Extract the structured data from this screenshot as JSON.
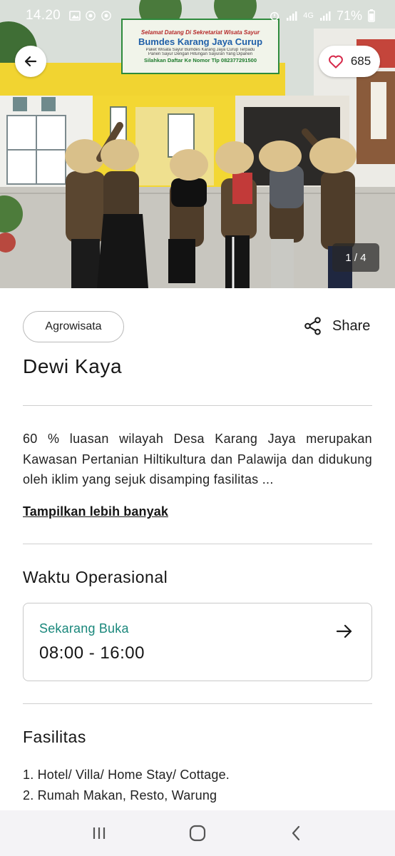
{
  "status_bar": {
    "time": "14.20",
    "battery": "71%",
    "network": "4G"
  },
  "hero": {
    "likes": "685",
    "image_counter": "1 / 4",
    "banner": {
      "top_line": "Selamat Datang Di Sekretariat Wisata Sayur",
      "title": "Bumdes Karang Jaya Curup",
      "line_1": "Paket Wisata Sayur Bumdes Karang Jaya Curup Terpadu",
      "line_2": "Panen Sayur Dengan Hitungan Sayuran Yang Dipanen",
      "bottom_line": "Silahkan Daftar Ke Nomor Tlp 082377291500"
    }
  },
  "chip": {
    "label": "Agrowisata"
  },
  "share": {
    "label": "Share"
  },
  "place": {
    "name": "Dewi Kaya"
  },
  "description": {
    "text": "60 % luasan wilayah Desa Karang Jaya merupakan Kawasan Pertanian Hiltikultura dan Palawija dan didukung oleh iklim yang sejuk disamping fasilitas ...",
    "more_link": "Tampilkan lebih banyak"
  },
  "operating_hours": {
    "section_title": "Waktu Operasional",
    "status": "Sekarang Buka",
    "hours": "08:00 - 16:00"
  },
  "facilities": {
    "section_title": "Fasilitas",
    "items": [
      "1. Hotel/ Villa/ Home Stay/ Cottage.",
      "2. Rumah Makan, Resto, Warung"
    ]
  },
  "icons": {
    "back": "arrow-left-icon",
    "like": "heart-outline-icon",
    "share": "share-nodes-icon",
    "card_arrow": "arrow-right-icon",
    "nav_recents": "recent-apps-icon",
    "nav_home": "home-icon",
    "nav_back": "chevron-left-icon"
  },
  "colors": {
    "accent_teal": "#19877b",
    "heart_red": "#d6294a",
    "text_dark": "#161616"
  }
}
